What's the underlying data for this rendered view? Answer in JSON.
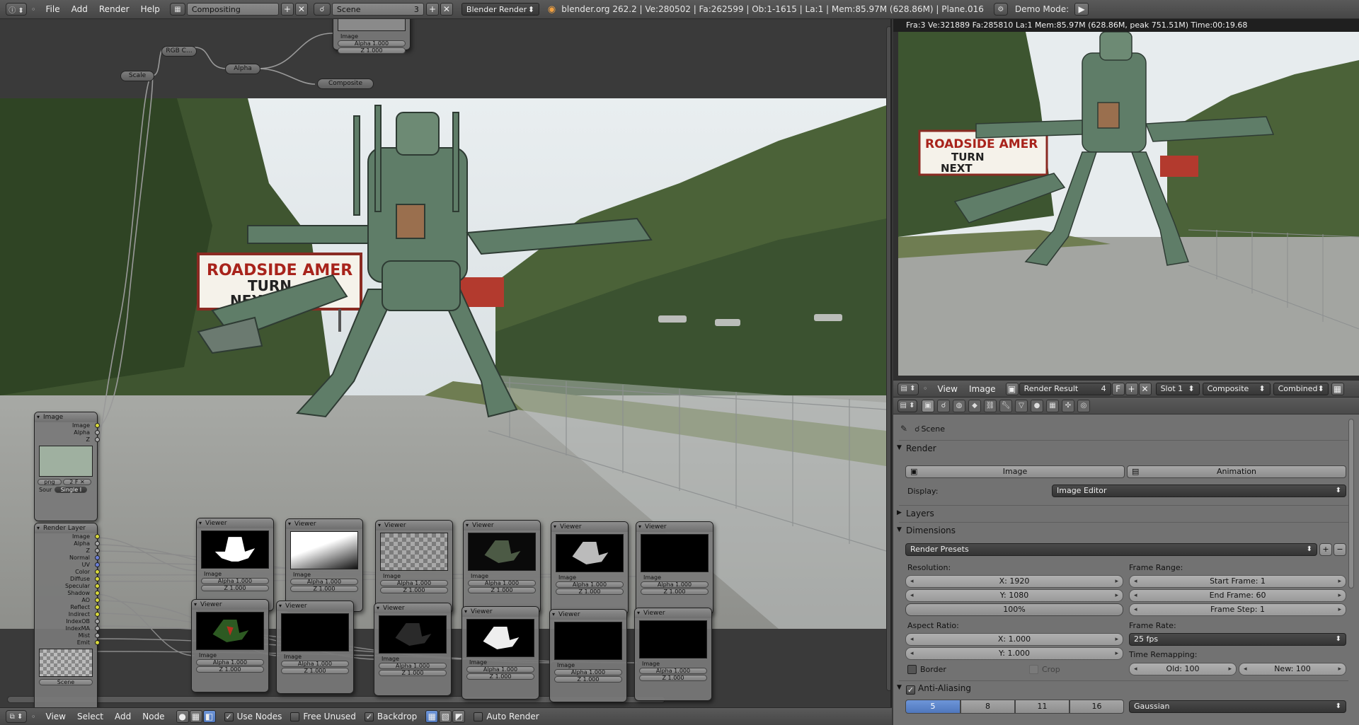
{
  "topbar": {
    "menus": [
      "File",
      "Add",
      "Render",
      "Help"
    ],
    "screen_layout": "Compositing",
    "scene": "Scene",
    "scene_users": "3",
    "engine": "Blender Render",
    "stats": "blender.org 262.2 | Ve:280502 | Fa:262599 | Ob:1-1615 | La:1 | Mem:85.97M (628.86M) | Plane.016",
    "demo_mode_label": "Demo Mode:"
  },
  "nodes": {
    "rgb_curves": "RGB C...",
    "alpha_over": "Alpha",
    "scale": "Scale",
    "composite": "Composite",
    "top_viewer": {
      "image_label": "Image",
      "alpha": "Alpha 1.000",
      "z": "Z 1.000"
    },
    "image_node": {
      "title": "Image",
      "outputs": [
        "Image",
        "Alpha",
        "Z"
      ],
      "source_label": "Sour",
      "source_value": "Single I",
      "file": "png"
    },
    "render_layers": {
      "title": "Render Layer",
      "outputs": [
        "Image",
        "Alpha",
        "Z",
        "Normal",
        "UV",
        "Color",
        "Diffuse",
        "Specular",
        "Shadow",
        "AO",
        "Reflect",
        "Indirect",
        "IndexOB",
        "IndexMA",
        "Mist",
        "Emit"
      ],
      "scene": "Scene"
    },
    "viewer_title": "Viewer",
    "viewer_image": "Image",
    "viewer_alpha": "Alpha 1.000",
    "viewer_z": "Z 1.000"
  },
  "node_footer": {
    "menus": [
      "View",
      "Select",
      "Add",
      "Node"
    ],
    "use_nodes": "Use Nodes",
    "free_unused": "Free Unused",
    "backdrop": "Backdrop",
    "auto_render": "Auto Render"
  },
  "image_editor": {
    "status": "Fra:3  Ve:321889 Fa:285810 La:1 Mem:85.97M (628.86M, peak 751.51M) Time:00:19.68",
    "menus": [
      "View",
      "Image"
    ],
    "image_name": "Render Result",
    "image_users": "4",
    "fake_user": "F",
    "slot": "Slot 1",
    "layer": "Composite",
    "pass": "Combined"
  },
  "properties": {
    "scene": "Scene",
    "render_panel": "Render",
    "image_button": "Image",
    "animation_button": "Animation",
    "display_label": "Display:",
    "display_value": "Image Editor",
    "layers_panel": "Layers",
    "dimensions_panel": "Dimensions",
    "render_presets": "Render Presets",
    "resolution_label": "Resolution:",
    "res_x": "X: 1920",
    "res_y": "Y: 1080",
    "res_pct": "100%",
    "frame_range_label": "Frame Range:",
    "start_frame": "Start Frame: 1",
    "end_frame": "End Frame: 60",
    "frame_step": "Frame Step: 1",
    "aspect_label": "Aspect Ratio:",
    "aspect_x": "X: 1.000",
    "aspect_y": "Y: 1.000",
    "frame_rate_label": "Frame Rate:",
    "frame_rate": "25 fps",
    "border": "Border",
    "crop": "Crop",
    "time_remap_label": "Time Remapping:",
    "old": "Old: 100",
    "new": "New: 100",
    "aa_panel": "Anti-Aliasing",
    "aa_samples": [
      "5",
      "8",
      "11",
      "16"
    ],
    "aa_filter": "Gaussian"
  },
  "billboard": {
    "line1": "ROADSIDE AMER",
    "line2": "TURN",
    "line3": "NEXT"
  }
}
